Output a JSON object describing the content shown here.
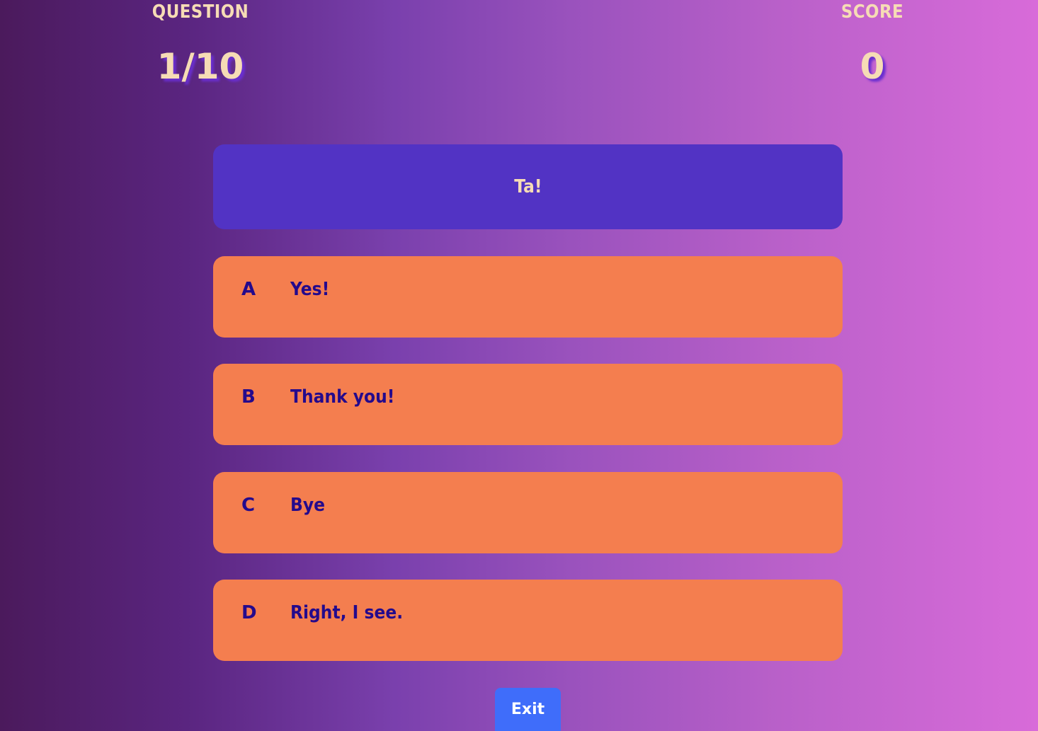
{
  "header": {
    "question_label": "QUESTION",
    "question_value": "1/10",
    "score_label": "SCORE",
    "score_value": "0"
  },
  "question": {
    "text": "Ta!"
  },
  "answers": [
    {
      "letter": "A",
      "text": "Yes!"
    },
    {
      "letter": "B",
      "text": "Thank you!"
    },
    {
      "letter": "C",
      "text": "Bye"
    },
    {
      "letter": "D",
      "text": "Right, I see."
    }
  ],
  "exit_label": "Exit",
  "colors": {
    "question_card": "#5233c4",
    "answer_card": "#f47e4f",
    "answer_text": "#240a8c",
    "header_text": "#f6dcb5",
    "exit_button": "#3f6dfa"
  }
}
